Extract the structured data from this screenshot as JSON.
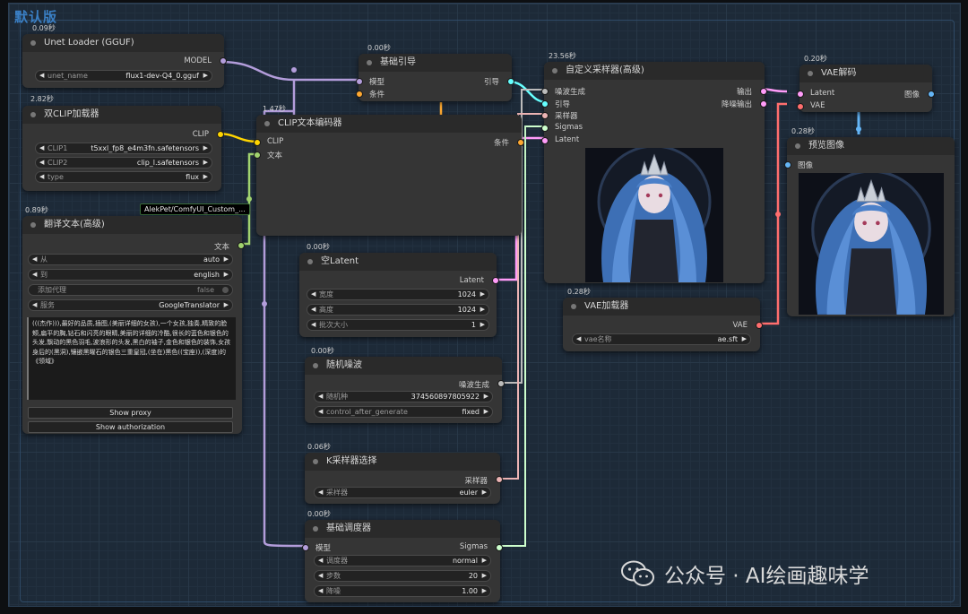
{
  "group": {
    "title": "默认版"
  },
  "nodes": {
    "unet_loader": {
      "timing": "0.09秒",
      "title": "Unet Loader (GGUF)",
      "output": "MODEL",
      "widgets": [
        {
          "label": "unet_name",
          "value": "flux1-dev-Q4_0.gguf"
        }
      ]
    },
    "dual_clip": {
      "timing": "2.82秒",
      "title": "双CLIP加载器",
      "output": "CLIP",
      "widgets": [
        {
          "label": "CLIP1",
          "value": "t5xxl_fp8_e4m3fn.safetensors"
        },
        {
          "label": "CLIP2",
          "value": "clip_l.safetensors"
        },
        {
          "label": "type",
          "value": "flux"
        }
      ]
    },
    "translate": {
      "timing": "0.89秒",
      "title": "翻译文本(高级)",
      "output": "文本",
      "tooltip": "AlekPet/ComfyUI_Custom_...",
      "widgets": [
        {
          "label": "从",
          "value": "auto"
        },
        {
          "label": "到",
          "value": "english"
        },
        {
          "label": "添加代理",
          "value": "false"
        },
        {
          "label": "服务",
          "value": "GoogleTranslator"
        }
      ],
      "text": "(((杰作))),最好的品质,插图,(美丽详细的女孩),一个女孩,独奏,精致的脸颊,扁平的胸,钻石和闪亮的眼睛,美丽的详细的冷酷,很长的蓝色和银色的头发,飘动的黑色羽毛,波浪形的头发,黑白的袖子,金色和银色的装饰,女孩身后的(黑洞),镶嵌黑曜石的银色三重皇冠,(坐在)黑色((宝座)),(深度)的《领域》",
      "buttons": [
        "Show proxy",
        "Show authorization"
      ]
    },
    "clip_encoder": {
      "timing": "1.47秒",
      "title": "CLIP文本编码器",
      "inputs": [
        "CLIP",
        "文本"
      ],
      "output": "条件"
    },
    "guidance": {
      "timing": "0.00秒",
      "title": "基础引导",
      "inputs": [
        "模型",
        "条件"
      ],
      "output": "引导"
    },
    "empty_latent": {
      "timing": "0.00秒",
      "title": "空Latent",
      "output": "Latent",
      "widgets": [
        {
          "label": "宽度",
          "value": "1024"
        },
        {
          "label": "高度",
          "value": "1024"
        },
        {
          "label": "批次大小",
          "value": "1"
        }
      ]
    },
    "noise": {
      "timing": "0.00秒",
      "title": "随机噪波",
      "output": "噪波生成",
      "widgets": [
        {
          "label": "随机种",
          "value": "374560897805922"
        },
        {
          "label": "control_after_generate",
          "value": "fixed"
        }
      ]
    },
    "sampler_select": {
      "timing": "0.06秒",
      "title": "K采样器选择",
      "output": "采样器",
      "widgets": [
        {
          "label": "采样器",
          "value": "euler"
        }
      ]
    },
    "scheduler": {
      "timing": "0.00秒",
      "title": "基础调度器",
      "inputs": [
        "模型"
      ],
      "output": "Sigmas",
      "widgets": [
        {
          "label": "调度器",
          "value": "normal"
        },
        {
          "label": "步数",
          "value": "20"
        },
        {
          "label": "降噪",
          "value": "1.00"
        }
      ]
    },
    "custom_sampler": {
      "timing": "23.56秒",
      "title": "自定义采样器(高级)",
      "inputs": [
        "噪波生成",
        "引导",
        "采样器",
        "Sigmas",
        "Latent"
      ],
      "outputs": [
        "输出",
        "降噪输出"
      ]
    },
    "vae_loader": {
      "timing": "0.28秒",
      "title": "VAE加载器",
      "output": "VAE",
      "widgets": [
        {
          "label": "vae名称",
          "value": "ae.sft"
        }
      ]
    },
    "vae_decode": {
      "timing": "0.20秒",
      "title": "VAE解码",
      "inputs": [
        "Latent",
        "VAE"
      ],
      "output": "图像"
    },
    "preview": {
      "timing": "0.28秒",
      "title": "预览图像",
      "inputs": [
        "图像"
      ]
    }
  },
  "watermark": {
    "text": "公众号 · AI绘画趣味学"
  },
  "colors": {
    "model": "#b39ddb",
    "clip": "#ffd500",
    "conditioning": "#ffa931",
    "latent": "#ff9cf9",
    "vae": "#ff6e6e",
    "image": "#64b5f6",
    "noise": "#b0b0b0",
    "sampler": "#ecb4b4",
    "sigmas": "#cdffcd",
    "guider": "#66ffff",
    "text": "#a1d36f"
  }
}
